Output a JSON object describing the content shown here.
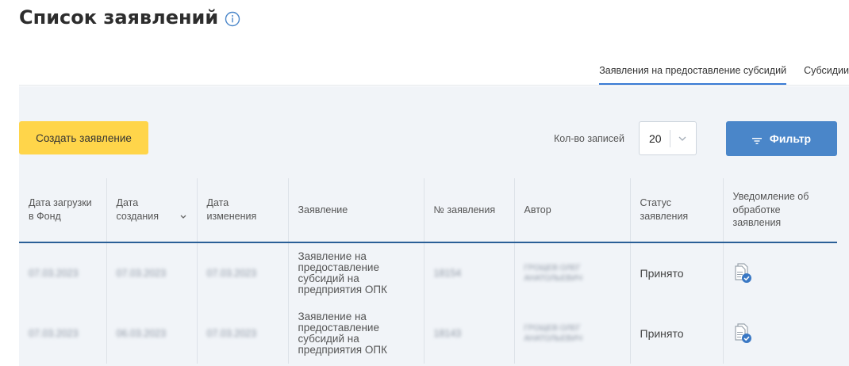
{
  "page": {
    "title": "Список заявлений"
  },
  "tabs": [
    {
      "label": "Заявления на предоставление субсидий",
      "active": true
    },
    {
      "label": "Субсидии",
      "active": false
    }
  ],
  "toolbar": {
    "create_label": "Создать заявление",
    "count_label": "Кол-во записей",
    "count_value": "20",
    "filter_label": "Фильтр"
  },
  "table": {
    "headers": {
      "upload": "Дата загрузки в Фонд",
      "created": "Дата создания",
      "changed": "Дата изменения",
      "application": "Заявление",
      "number": "№ заявления",
      "author": "Автор",
      "status": "Статус заявления",
      "notice": "Уведомление об обработке заявления"
    },
    "rows": [
      {
        "upload": "07.03.2023",
        "created": "07.03.2023",
        "changed": "07.03.2023",
        "application": "Заявление на предоставление субсидий на предприятия ОПК",
        "number": "18154",
        "author": "ГРОЩЕВ ОЛЕГ АНАТОЛЬЕВИЧ",
        "status": "Принято"
      },
      {
        "upload": "07.03.2023",
        "created": "06.03.2023",
        "changed": "07.03.2023",
        "application": "Заявление на предоставление субсидий на предприятия ОПК",
        "number": "18143",
        "author": "ГРОЩЕВ ОЛЕГ АНАТОЛЬЕВИЧ",
        "status": "Принято"
      }
    ]
  },
  "colors": {
    "accent": "#4a86c9",
    "create": "#ffd54a",
    "tab_underline": "#3a7bd5",
    "header_line": "#2a5f97"
  },
  "icons": {
    "info": "info-icon",
    "chevron": "chevron-down-icon",
    "filter": "filter-icon",
    "document": "document-check-icon"
  }
}
